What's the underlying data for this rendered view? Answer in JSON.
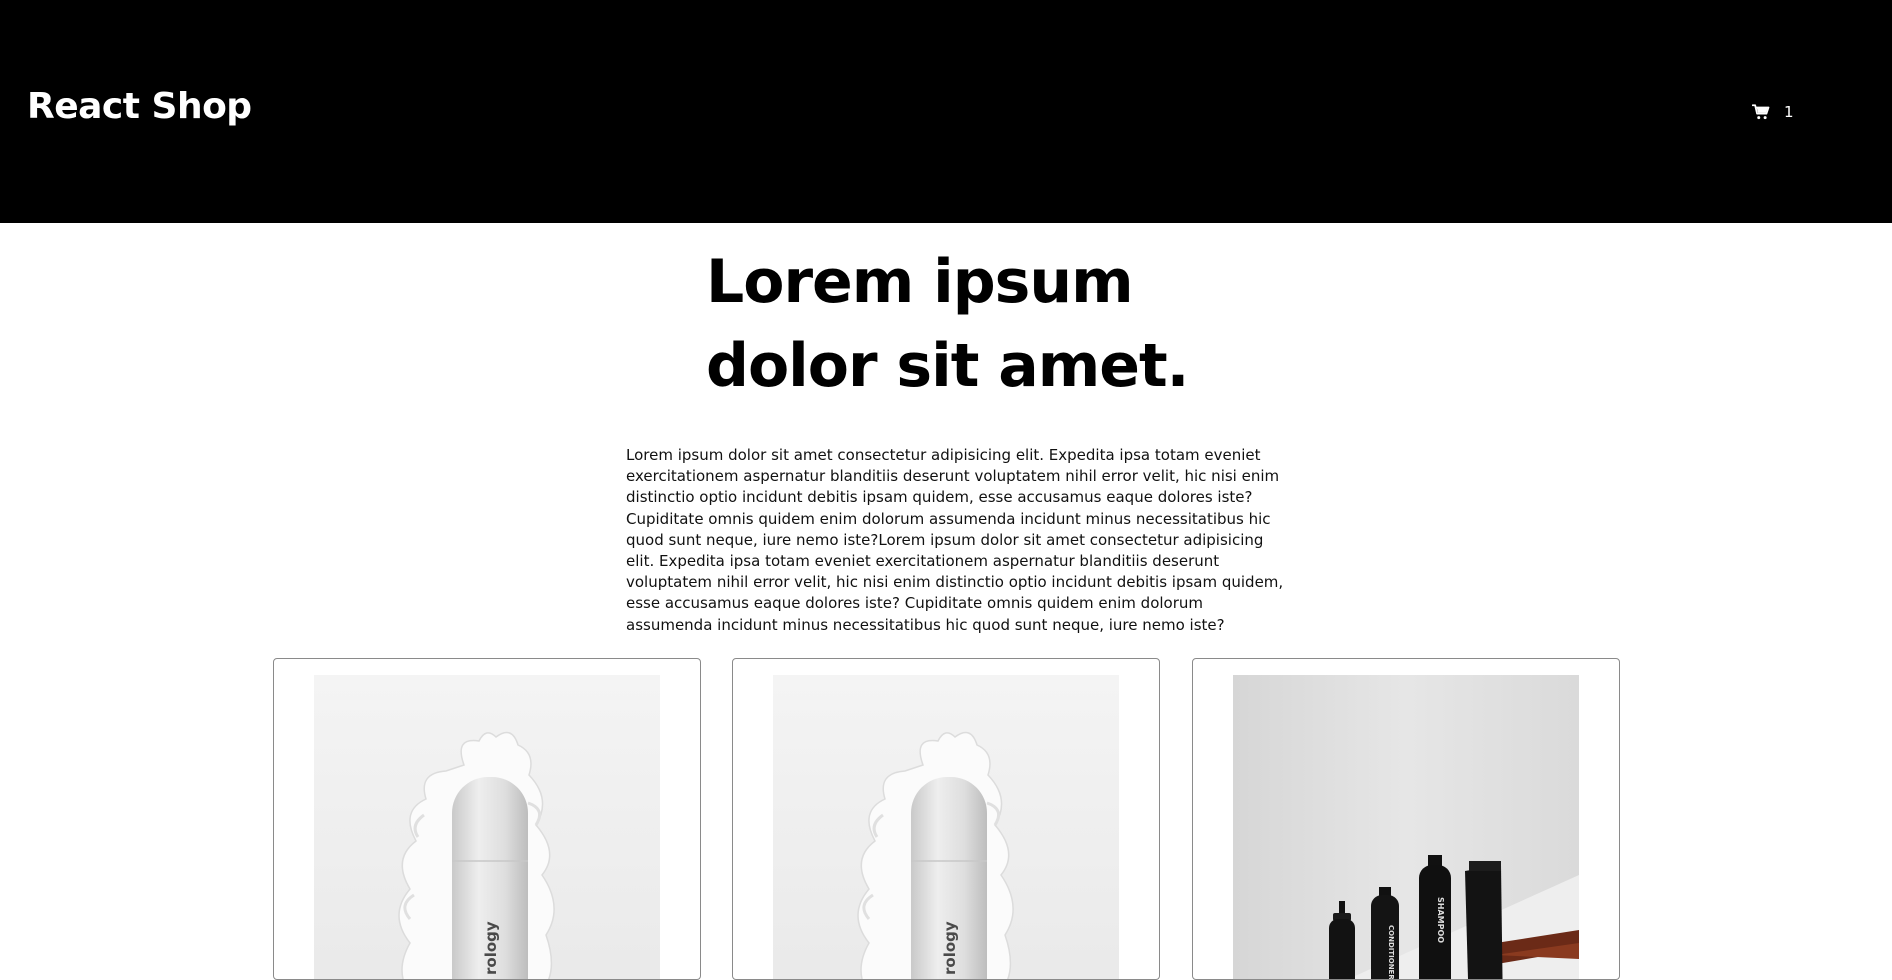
{
  "navbar": {
    "brand": "React Shop",
    "cart_icon": "shopping-cart-icon",
    "cart_count": "1"
  },
  "hero": {
    "title_line1": "Lorem ipsum",
    "title_line2": "dolor sit amet.",
    "paragraph": "Lorem ipsum dolor sit amet consectetur adipisicing elit. Expedita ipsa totam eveniet exercitationem aspernatur blanditiis deserunt voluptatem nihil error velit, hic nisi enim distinctio optio incidunt debitis ipsam quidem, esse accusamus eaque dolores iste? Cupiditate omnis quidem enim dolorum assumenda incidunt minus necessitatibus hic quod sunt neque, iure nemo iste?Lorem ipsum dolor sit amet consectetur adipisicing elit. Expedita ipsa totam eveniet exercitationem aspernatur blanditiis deserunt voluptatem nihil error velit, hic nisi enim distinctio optio incidunt debitis ipsam quidem, esse accusamus eaque dolores iste? Cupiditate omnis quidem enim dolorum assumenda incidunt minus necessitatibus hic quod sunt neque, iure nemo iste?"
  },
  "products": [
    {
      "image": "white-bottle-splash-image",
      "bottle_text": "rology"
    },
    {
      "image": "white-bottle-splash-image",
      "bottle_text": "rology"
    },
    {
      "image": "black-haircare-bottles-image",
      "bottle_labels": [
        "CONDITIONER",
        "SHAMPOO"
      ]
    }
  ],
  "colors": {
    "navbar_bg": "#000000",
    "navbar_text": "#ffffff",
    "page_bg": "#ffffff",
    "card_border": "#8a8a8a"
  }
}
